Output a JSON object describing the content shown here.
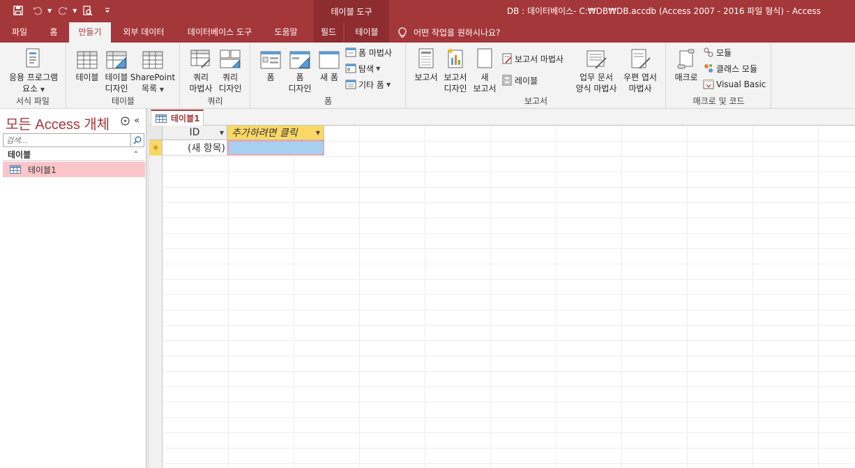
{
  "titlebar": {
    "context_tab_header": "테이블 도구",
    "window_title": "DB : 데이터베이스- C:₩DB₩DB.accdb (Access 2007 - 2016 파일 형식)  -  Access"
  },
  "tabs": {
    "file": "파일",
    "home": "홈",
    "create": "만들기",
    "external_data": "외부 데이터",
    "database_tools": "데이터베이스 도구",
    "help": "도움말",
    "fields": "필드",
    "table": "테이블",
    "tell_me": "어떤 작업을 원하시나요?"
  },
  "ribbon": {
    "templates": {
      "app_parts_l1": "응용 프로그램",
      "app_parts_l2": "요소",
      "label": "서식 파일"
    },
    "tables": {
      "table": "테이블",
      "table_design_l1": "테이블",
      "table_design_l2": "디자인",
      "sharepoint_l1": "SharePoint",
      "sharepoint_l2": "목록",
      "label": "테이블"
    },
    "queries": {
      "wizard_l1": "쿼리",
      "wizard_l2": "마법사",
      "design_l1": "쿼리",
      "design_l2": "디자인",
      "label": "쿼리"
    },
    "forms": {
      "form": "폼",
      "form_design_l1": "폼",
      "form_design_l2": "디자인",
      "blank_l1": "새 폼",
      "form_wizard": "폼 마법사",
      "navigation": "탐색",
      "more_forms": "기타 폼",
      "label": "폼"
    },
    "reports": {
      "report": "보고서",
      "report_design_l1": "보고서",
      "report_design_l2": "디자인",
      "blank_l1": "새",
      "blank_l2": "보고서",
      "report_wizard": "보고서 마법사",
      "labels": "레이블",
      "label": "보고서"
    },
    "biz": {
      "biz_form_l1": "업무 문서",
      "biz_form_l2": "양식 마법사",
      "postal_l1": "우편 엽서",
      "postal_l2": "마법사"
    },
    "macros": {
      "macro": "매크로",
      "module": "모듈",
      "class_module": "클래스 모듈",
      "vba": "Visual Basic",
      "label": "매크로 및 코드"
    }
  },
  "navpane": {
    "title": "모든 Access 개체",
    "search_placeholder": "검색...",
    "section": "테이블",
    "items": [
      "테이블1"
    ]
  },
  "document": {
    "tab_label": "테이블1",
    "columns": [
      "ID",
      "추가하려면 클릭"
    ],
    "new_row_id": "(새 항목)"
  },
  "colors": {
    "accent": "#a4373a",
    "header_highlight": "#fbd866",
    "nav_selected": "#f9c5c9",
    "cell_selected": "#a9cff1"
  }
}
